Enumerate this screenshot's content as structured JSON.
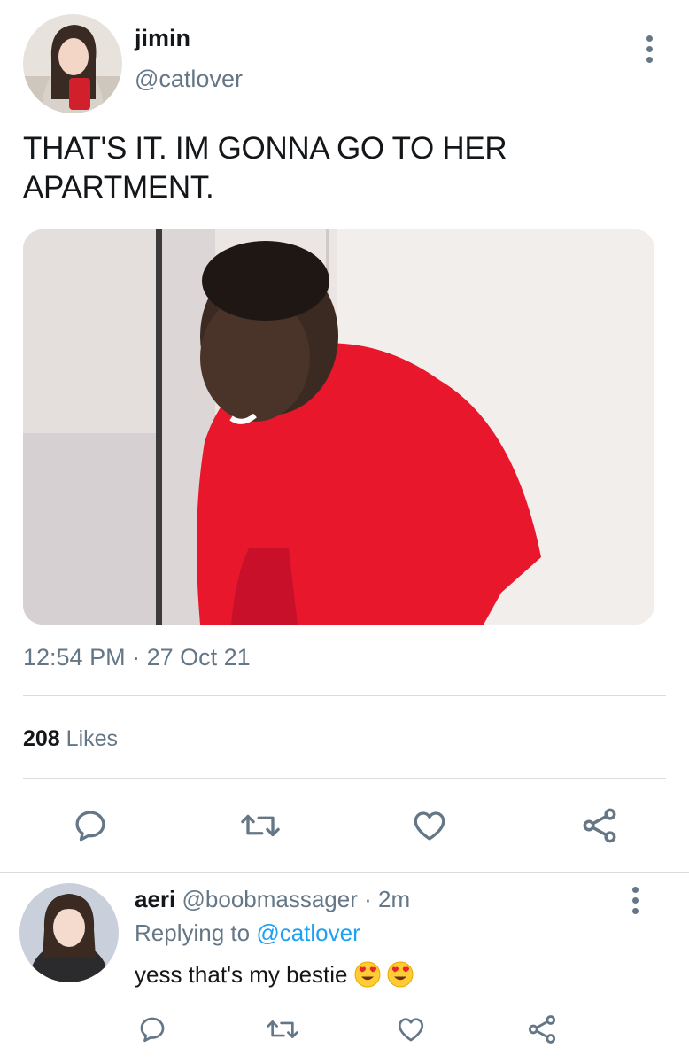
{
  "tweet": {
    "author": {
      "name": "jimin",
      "handle": "@catlover"
    },
    "text": "THAT'S IT. IM GONNA GO TO HER APARTMENT.",
    "media_description": "",
    "time": "12:54 PM",
    "separator": "·",
    "date": "27 Oct 21",
    "likes_count": "208",
    "likes_label": "Likes",
    "actions": [
      "reply-icon",
      "retweet-icon",
      "like-icon",
      "share-icon"
    ]
  },
  "reply": {
    "author": {
      "name": "aeri",
      "handle": "@boobmassager",
      "separator": "·",
      "time": "2m"
    },
    "replying_prefix": "Replying to",
    "replying_handle": "@catlover",
    "text": "yess that's my bestie",
    "emojis": [
      "heart-eyes-emoji",
      "heart-eyes-emoji"
    ],
    "actions": [
      "reply-icon",
      "retweet-icon",
      "like-icon",
      "share-icon"
    ]
  },
  "colors": {
    "text": "#14171a",
    "secondary": "#657786",
    "link": "#1da1f2",
    "divider": "#d9dde1"
  }
}
